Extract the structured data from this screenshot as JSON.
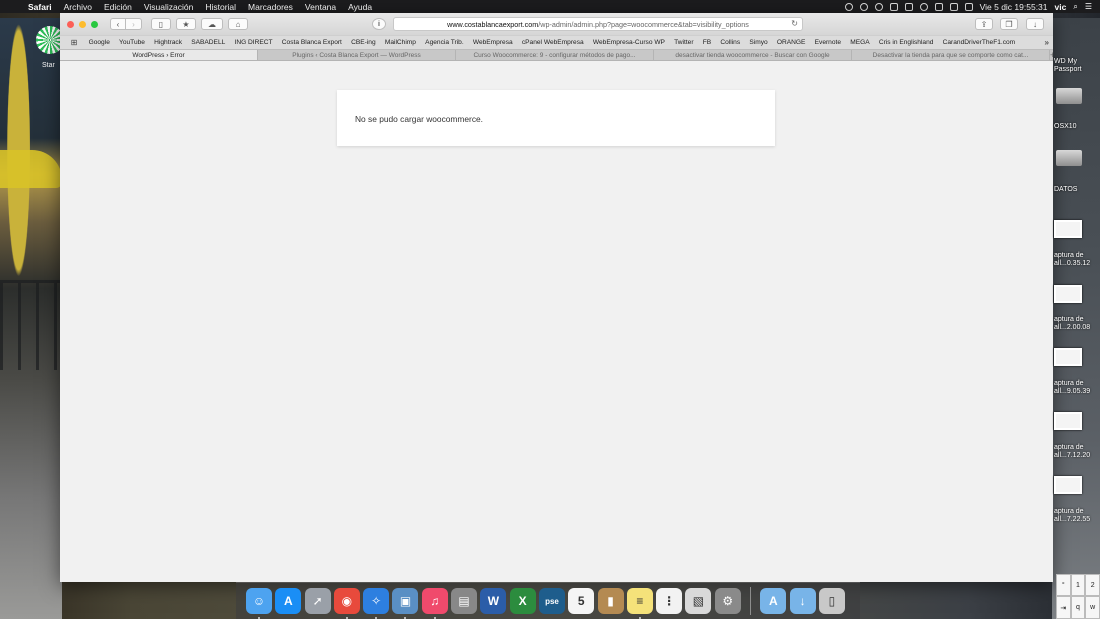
{
  "menubar": {
    "app": "Safari",
    "items": [
      "Archivo",
      "Edición",
      "Visualización",
      "Historial",
      "Marcadores",
      "Ventana",
      "Ayuda"
    ],
    "clock": "Vie 5 dic  19:55:31",
    "user": "vic"
  },
  "browser": {
    "url_domain": "www.costablancaexport.com",
    "url_path": "/wp-admin/admin.php?page=woocommerce&tab=visibility_options",
    "bookmarks": [
      "Google",
      "YouTube",
      "Hightrack",
      "SABADELL",
      "ING DIRECT",
      "Costa Blanca Export",
      "CBE-ing",
      "MailChimp",
      "Agencia Trib.",
      "WebEmpresa",
      "cPanel WebEmpresa",
      "WebEmpresa-Curso WP",
      "Twitter",
      "FB",
      "Collins",
      "Simyo",
      "ORANGE",
      "Evernote",
      "MEGA",
      "Cris in Englishland",
      "CarandDriverTheF1.com"
    ],
    "tabs": [
      "WordPress › Error",
      "Plugins ‹ Costa Blanca Export — WordPress",
      "Curso Woocommerce: 9 - configurar métodos de pago...",
      "desactivar tienda woocommerce - Buscar con Google",
      "Desactivar la tienda para que se comporte como cat..."
    ]
  },
  "page": {
    "error_message": "No se pudo cargar woocommerce."
  },
  "desktop": {
    "left_label": "Star",
    "right_items": [
      "WD My Passport",
      "OSX10",
      "DATOS",
      "aptura de all...0.35.12",
      "aptura de all...2.00.08",
      "aptura de all...9.05.39",
      "aptura de all...7.12.20",
      "aptura de all...7.22.55"
    ]
  },
  "dock": {
    "apps": [
      {
        "name": "finder-icon",
        "color": "#4da3f0",
        "glyph": "☺"
      },
      {
        "name": "app-store-icon",
        "color": "#1a8ef5",
        "glyph": "A"
      },
      {
        "name": "launchpad-icon",
        "color": "#9aa0a8",
        "glyph": "➚"
      },
      {
        "name": "chrome-icon",
        "color": "#e84a3c",
        "glyph": "◉"
      },
      {
        "name": "safari-icon",
        "color": "#2d7fe0",
        "glyph": "✧"
      },
      {
        "name": "preview-icon",
        "color": "#5a8fc4",
        "glyph": "▣"
      },
      {
        "name": "itunes-icon",
        "color": "#f04a6c",
        "glyph": "♫"
      },
      {
        "name": "scanner-icon",
        "color": "#888888",
        "glyph": "▤"
      },
      {
        "name": "word-icon",
        "color": "#2b5da8",
        "glyph": "W"
      },
      {
        "name": "excel-icon",
        "color": "#2c8c3e",
        "glyph": "X"
      },
      {
        "name": "photoshop-icon",
        "color": "#1e5d8c",
        "glyph": "pse"
      },
      {
        "name": "calendar-icon",
        "color": "#f5f5f5",
        "glyph": "5"
      },
      {
        "name": "contacts-icon",
        "color": "#b48a52",
        "glyph": "▮"
      },
      {
        "name": "notes-icon",
        "color": "#f5e27a",
        "glyph": "≡"
      },
      {
        "name": "reminders-icon",
        "color": "#f2f2f2",
        "glyph": "⋮"
      },
      {
        "name": "preview-photos-icon",
        "color": "#d9d9d9",
        "glyph": "▧"
      },
      {
        "name": "system-preferences-icon",
        "color": "#8a8a8a",
        "glyph": "⚙"
      }
    ],
    "folders": [
      {
        "name": "applications-folder-icon",
        "color": "#78b4e8",
        "glyph": "A"
      },
      {
        "name": "downloads-folder-icon",
        "color": "#78b4e8",
        "glyph": "↓"
      },
      {
        "name": "trash-icon",
        "color": "#c8c8c8",
        "glyph": "▯"
      }
    ]
  }
}
